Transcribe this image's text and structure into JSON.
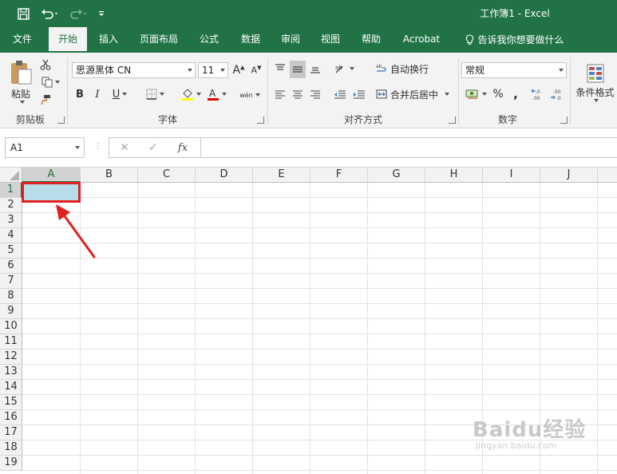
{
  "window": {
    "title": "工作簿1  -  Excel"
  },
  "quick_access": {
    "save_icon": "save-icon",
    "undo_icon": "undo-icon",
    "redo_icon": "redo-icon",
    "customize_icon": "customize-icon"
  },
  "tabs": [
    {
      "label": "文件"
    },
    {
      "label": "开始"
    },
    {
      "label": "插入"
    },
    {
      "label": "页面布局"
    },
    {
      "label": "公式"
    },
    {
      "label": "数据"
    },
    {
      "label": "审阅"
    },
    {
      "label": "视图"
    },
    {
      "label": "帮助"
    },
    {
      "label": "Acrobat"
    },
    {
      "label": "告诉我你想要做什么"
    }
  ],
  "ribbon": {
    "clipboard": {
      "paste_label": "粘贴",
      "group_label": "剪贴板"
    },
    "font": {
      "font_name": "思源黑体 CN",
      "font_size": "11",
      "group_label": "字体",
      "bold": "B",
      "italic": "I",
      "underline": "U",
      "phonetic": "wén"
    },
    "alignment": {
      "wrap_text": "自动换行",
      "merge_center": "合并后居中",
      "group_label": "对齐方式"
    },
    "number": {
      "format": "常规",
      "percent": "%",
      "comma": ",",
      "group_label": "数字"
    },
    "styles": {
      "conditional_format": "条件格式"
    }
  },
  "formula_bar": {
    "name_box": "A1",
    "cancel": "✕",
    "enter": "✓",
    "fx": "fx",
    "formula": ""
  },
  "columns": [
    "A",
    "B",
    "C",
    "D",
    "E",
    "F",
    "G",
    "H",
    "I",
    "J"
  ],
  "rows": [
    "1",
    "2",
    "3",
    "4",
    "5",
    "6",
    "7",
    "8",
    "9",
    "10",
    "11",
    "12",
    "13",
    "14",
    "15",
    "16",
    "17",
    "18",
    "19"
  ],
  "selected_cell": "A1",
  "selected_fill": "#b7dee8",
  "highlight_color": "#e02020",
  "accent_color": "#217346",
  "watermark": {
    "brand": "Baidu经验",
    "url": "jingyan.baidu.com"
  }
}
